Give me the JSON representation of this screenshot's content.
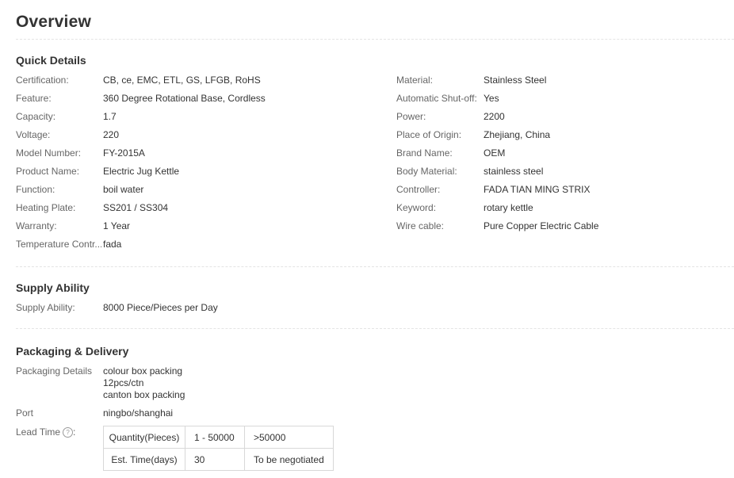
{
  "overview": {
    "title": "Overview"
  },
  "quick_details": {
    "title": "Quick Details",
    "left": [
      {
        "key": "Certification:",
        "value": "CB, ce, EMC, ETL, GS, LFGB, RoHS"
      },
      {
        "key": "Feature:",
        "value": "360 Degree Rotational Base, Cordless"
      },
      {
        "key": "Capacity:",
        "value": "1.7"
      },
      {
        "key": "Voltage:",
        "value": "220"
      },
      {
        "key": "Model Number:",
        "value": "FY-2015A"
      },
      {
        "key": "Product Name:",
        "value": "Electric Jug Kettle"
      },
      {
        "key": "Function:",
        "value": "boil water"
      },
      {
        "key": "Heating Plate:",
        "value": "SS201 / SS304"
      },
      {
        "key": "Warranty:",
        "value": "1 Year"
      },
      {
        "key": "Temperature Contr...",
        "value": "fada"
      }
    ],
    "right": [
      {
        "key": "Material:",
        "value": "Stainless Steel"
      },
      {
        "key": "Automatic Shut-off:",
        "value": "Yes"
      },
      {
        "key": "Power:",
        "value": "2200"
      },
      {
        "key": "Place of Origin:",
        "value": "Zhejiang, China"
      },
      {
        "key": "Brand Name:",
        "value": "OEM"
      },
      {
        "key": "Body Material:",
        "value": "stainless steel"
      },
      {
        "key": "Controller:",
        "value": "FADA TIAN MING STRIX"
      },
      {
        "key": "Keyword:",
        "value": "rotary kettle"
      },
      {
        "key": "Wire cable:",
        "value": "Pure Copper Electric Cable"
      }
    ]
  },
  "supply_ability": {
    "title": "Supply Ability",
    "key": "Supply Ability:",
    "value": "8000 Piece/Pieces per Day"
  },
  "packaging": {
    "title": "Packaging & Delivery",
    "details_key": "Packaging Details",
    "details_lines": [
      "colour box packing",
      "12pcs/ctn",
      "canton box packing"
    ],
    "port_key": "Port",
    "port_value": "ningbo/shanghai",
    "lead_time_key": "Lead Time",
    "lead_time_colon": ":",
    "help_icon": "?",
    "lead_table": [
      [
        "Quantity(Pieces)",
        "1 - 50000",
        ">50000"
      ],
      [
        "Est. Time(days)",
        "30",
        "To be negotiated"
      ]
    ]
  }
}
